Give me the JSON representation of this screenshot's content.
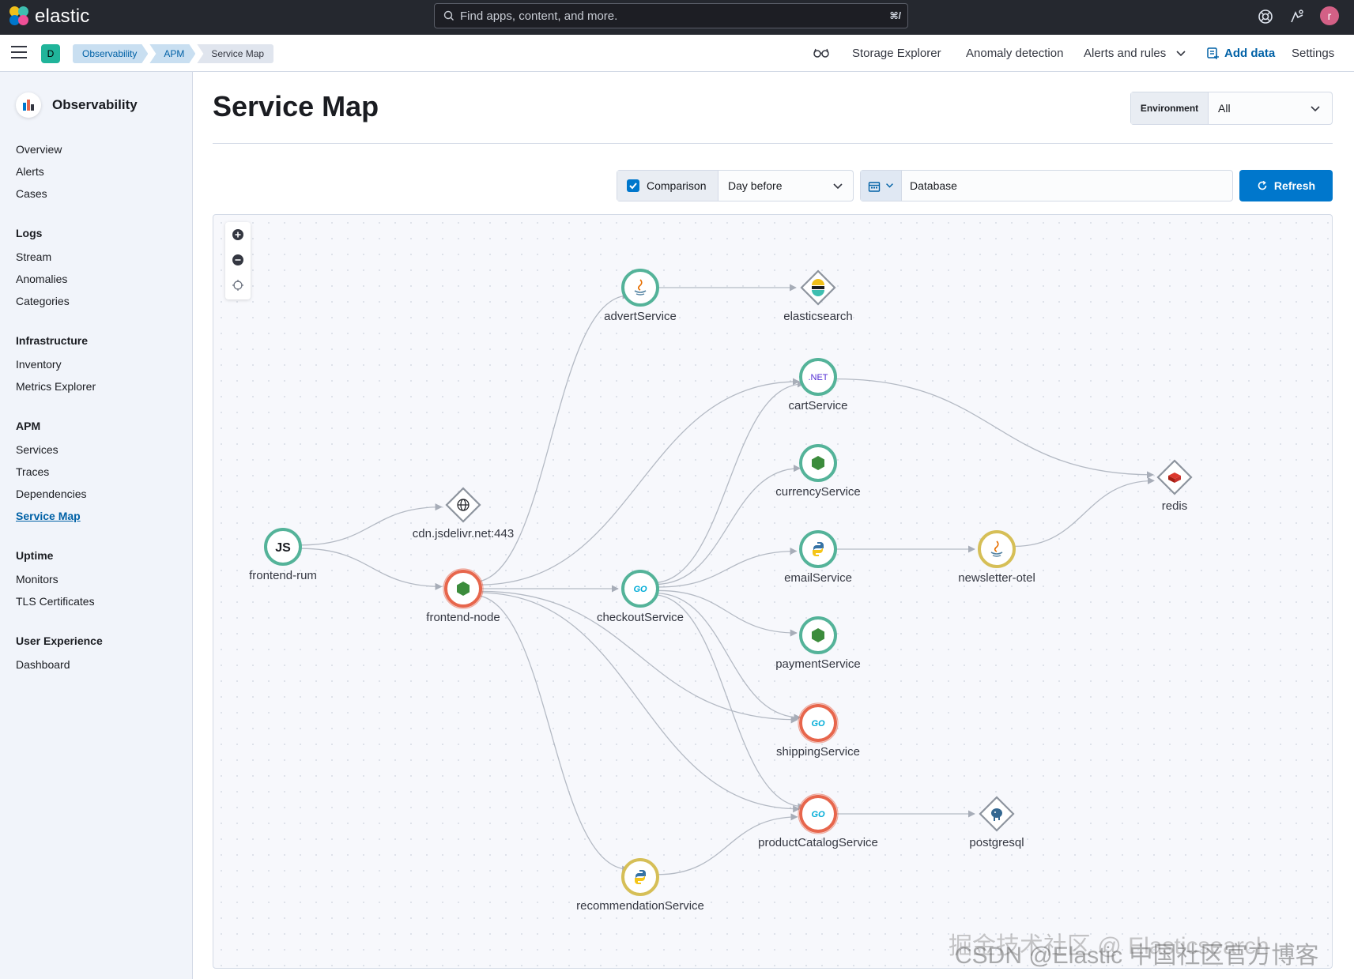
{
  "header": {
    "logo_text": "elastic",
    "search_placeholder": "Find apps, content, and more.",
    "search_shortcut": "⌘/",
    "avatar_initial": "r"
  },
  "subbar": {
    "space_initial": "D",
    "breadcrumbs": [
      "Observability",
      "APM",
      "Service Map"
    ],
    "links": {
      "storage_explorer": "Storage Explorer",
      "anomaly_detection": "Anomaly detection",
      "alerts_and_rules": "Alerts and rules",
      "add_data": "Add data",
      "settings": "Settings"
    }
  },
  "sidebar": {
    "title": "Observability",
    "top_items": [
      "Overview",
      "Alerts",
      "Cases"
    ],
    "sections": [
      {
        "title": "Logs",
        "items": [
          "Stream",
          "Anomalies",
          "Categories"
        ]
      },
      {
        "title": "Infrastructure",
        "items": [
          "Inventory",
          "Metrics Explorer"
        ]
      },
      {
        "title": "APM",
        "items": [
          "Services",
          "Traces",
          "Dependencies",
          "Service Map"
        ]
      },
      {
        "title": "Uptime",
        "items": [
          "Monitors",
          "TLS Certificates"
        ]
      },
      {
        "title": "User Experience",
        "items": [
          "Dashboard"
        ]
      }
    ],
    "active_item": "Service Map"
  },
  "main": {
    "title": "Service Map",
    "environment": {
      "label": "Environment",
      "value": "All"
    },
    "comparison": {
      "label": "Comparison",
      "checked": true,
      "value": "Day before"
    },
    "kql_query": "Database",
    "refresh_label": "Refresh"
  },
  "service_map": {
    "nodes": [
      {
        "id": "frontend-rum",
        "label": "frontend-rum",
        "kind": "service",
        "icon": "JS",
        "ring": "#54b399"
      },
      {
        "id": "cdn",
        "label": "cdn.jsdelivr.net:443",
        "kind": "external",
        "icon": "globe-icon"
      },
      {
        "id": "frontend-node",
        "label": "frontend-node",
        "kind": "service",
        "icon": "nodejs-icon",
        "ring": "#e7664c"
      },
      {
        "id": "advertService",
        "label": "advertService",
        "kind": "service",
        "icon": "java-icon",
        "ring": "#54b399"
      },
      {
        "id": "elasticsearch",
        "label": "elasticsearch",
        "kind": "dependency",
        "icon": "elasticsearch-icon"
      },
      {
        "id": "cartService",
        "label": "cartService",
        "kind": "service",
        "icon": ".NET",
        "ring": "#54b399"
      },
      {
        "id": "currencyService",
        "label": "currencyService",
        "kind": "service",
        "icon": "nodejs-icon",
        "ring": "#54b399"
      },
      {
        "id": "emailService",
        "label": "emailService",
        "kind": "service",
        "icon": "python-icon",
        "ring": "#54b399"
      },
      {
        "id": "checkoutService",
        "label": "checkoutService",
        "kind": "service",
        "icon": "GO",
        "ring": "#54b399"
      },
      {
        "id": "paymentService",
        "label": "paymentService",
        "kind": "service",
        "icon": "nodejs-icon",
        "ring": "#54b399"
      },
      {
        "id": "shippingService",
        "label": "shippingService",
        "kind": "service",
        "icon": "GO",
        "ring": "#e7664c"
      },
      {
        "id": "productCatalogService",
        "label": "productCatalogService",
        "kind": "service",
        "icon": "GO",
        "ring": "#e7664c"
      },
      {
        "id": "recommendationService",
        "label": "recommendationService",
        "kind": "service",
        "icon": "python-icon",
        "ring": "#d6bf57"
      },
      {
        "id": "newsletter-otel",
        "label": "newsletter-otel",
        "kind": "service",
        "icon": "java-icon",
        "ring": "#d6bf57"
      },
      {
        "id": "redis",
        "label": "redis",
        "kind": "dependency",
        "icon": "redis-icon"
      },
      {
        "id": "postgresql",
        "label": "postgresql",
        "kind": "dependency",
        "icon": "postgresql-icon"
      }
    ],
    "edges": [
      [
        "frontend-rum",
        "cdn"
      ],
      [
        "frontend-rum",
        "frontend-node"
      ],
      [
        "frontend-node",
        "advertService"
      ],
      [
        "frontend-node",
        "cartService"
      ],
      [
        "frontend-node",
        "checkoutService"
      ],
      [
        "frontend-node",
        "productCatalogService"
      ],
      [
        "frontend-node",
        "recommendationService"
      ],
      [
        "frontend-node",
        "shippingService"
      ],
      [
        "advertService",
        "elasticsearch"
      ],
      [
        "cartService",
        "redis"
      ],
      [
        "checkoutService",
        "cartService"
      ],
      [
        "checkoutService",
        "currencyService"
      ],
      [
        "checkoutService",
        "emailService"
      ],
      [
        "checkoutService",
        "paymentService"
      ],
      [
        "checkoutService",
        "shippingService"
      ],
      [
        "checkoutService",
        "productCatalogService"
      ],
      [
        "emailService",
        "newsletter-otel"
      ],
      [
        "newsletter-otel",
        "redis"
      ],
      [
        "productCatalogService",
        "postgresql"
      ],
      [
        "recommendationService",
        "productCatalogService"
      ]
    ]
  },
  "watermark": {
    "line1": "掘金技术社区 @ Elasticsearch",
    "line2": "CSDN @Elastic 中国社区官方博客"
  },
  "colors": {
    "header_bg": "#25282f",
    "accent": "#0077cc",
    "ring_healthy": "#54b399",
    "ring_critical": "#e7664c",
    "ring_warning": "#d6bf57"
  }
}
